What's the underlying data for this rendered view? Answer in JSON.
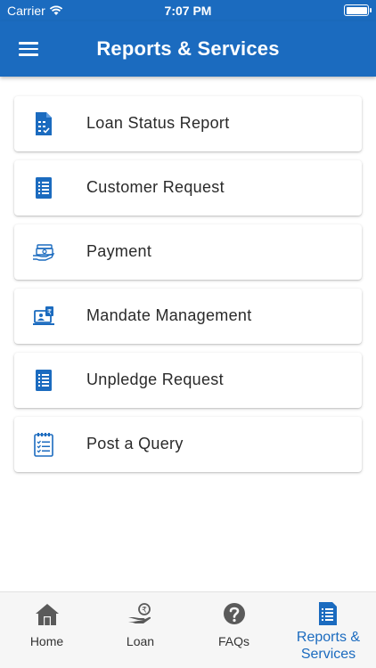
{
  "status_bar": {
    "carrier": "Carrier",
    "time": "7:07 PM"
  },
  "header": {
    "title": "Reports & Services"
  },
  "items": [
    {
      "label": "Loan Status Report",
      "icon": "document-checklist-icon"
    },
    {
      "label": "Customer Request",
      "icon": "document-list-icon"
    },
    {
      "label": "Payment",
      "icon": "payment-hand-icon"
    },
    {
      "label": "Mandate Management",
      "icon": "laptop-rupee-icon"
    },
    {
      "label": "Unpledge Request",
      "icon": "document-list-icon"
    },
    {
      "label": "Post a Query",
      "icon": "notepad-icon"
    }
  ],
  "tabs": [
    {
      "label": "Home",
      "icon": "home-icon"
    },
    {
      "label": "Loan",
      "icon": "loan-hand-icon"
    },
    {
      "label": "FAQs",
      "icon": "question-icon"
    },
    {
      "label": "Reports & Services",
      "icon": "report-document-icon"
    }
  ],
  "colors": {
    "primary": "#1b6bbf",
    "text": "#2a2a2a",
    "inactive_icon": "#5a5a5a"
  }
}
